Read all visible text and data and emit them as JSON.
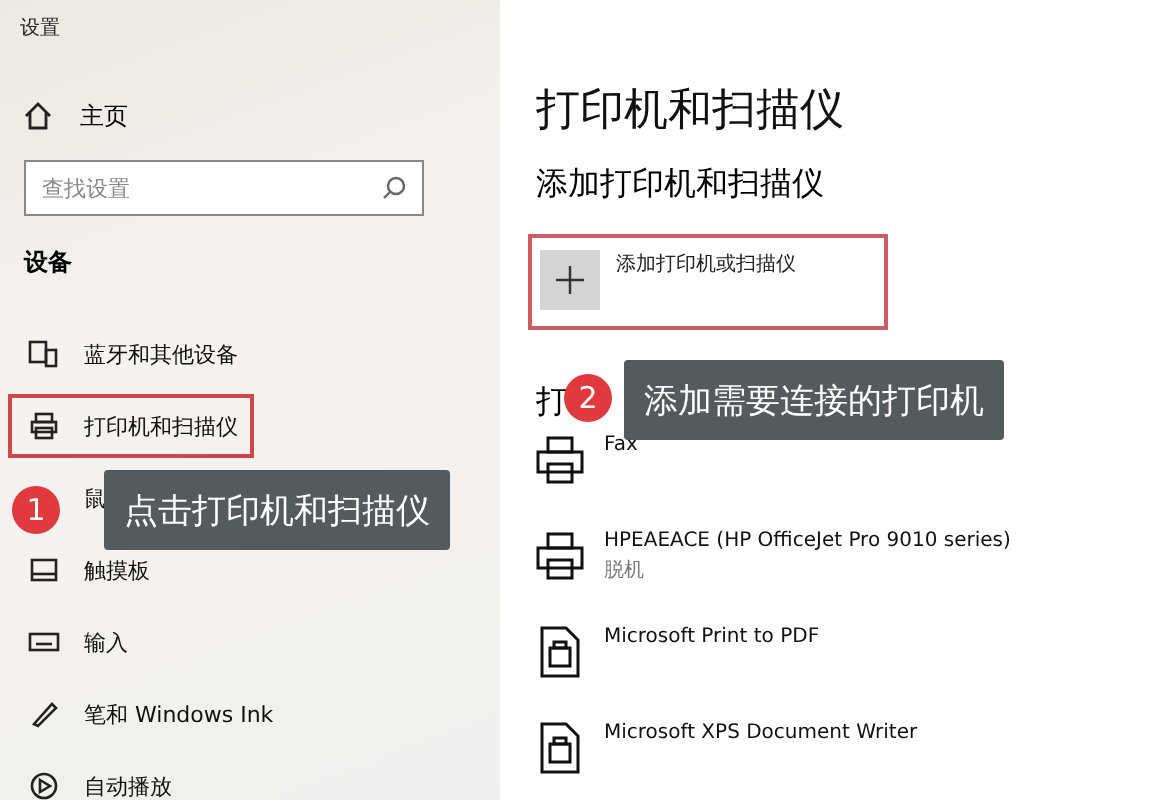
{
  "window": {
    "title": "设置"
  },
  "sidebar": {
    "home": "主页",
    "search": {
      "placeholder": "查找设置"
    },
    "section": "设备",
    "items": [
      {
        "label": "蓝牙和其他设备",
        "kind": "bluetooth",
        "selected": false
      },
      {
        "label": "打印机和扫描仪",
        "kind": "printer",
        "selected": true
      },
      {
        "label": "鼠",
        "selected": false
      },
      {
        "label": "触摸板",
        "kind": "touchpad",
        "selected": false
      },
      {
        "label": "输入",
        "kind": "keyboard",
        "selected": false
      },
      {
        "label": "笔和 Windows Ink",
        "kind": "pen",
        "selected": false
      },
      {
        "label": "自动播放",
        "kind": "autoplay",
        "selected": false
      }
    ]
  },
  "main": {
    "title": "打印机和扫描仪",
    "add_section": "添加打印机和扫描仪",
    "add_button": {
      "label": "添加打印机或扫描仪",
      "highlighted": true
    },
    "list_heading": "打",
    "printers": [
      {
        "name": "Fax",
        "kind": "printer"
      },
      {
        "name": "HPEAEACE (HP OfficeJet Pro 9010 series)",
        "status": "脱机",
        "kind": "printer"
      },
      {
        "name": "Microsoft Print to PDF",
        "kind": "document"
      },
      {
        "name": "Microsoft XPS Document Writer",
        "kind": "document"
      }
    ]
  },
  "callouts": [
    {
      "number": "1",
      "text": "点击打印机和扫描仪"
    },
    {
      "number": "2",
      "text": "添加需要连接的打印机"
    }
  ]
}
